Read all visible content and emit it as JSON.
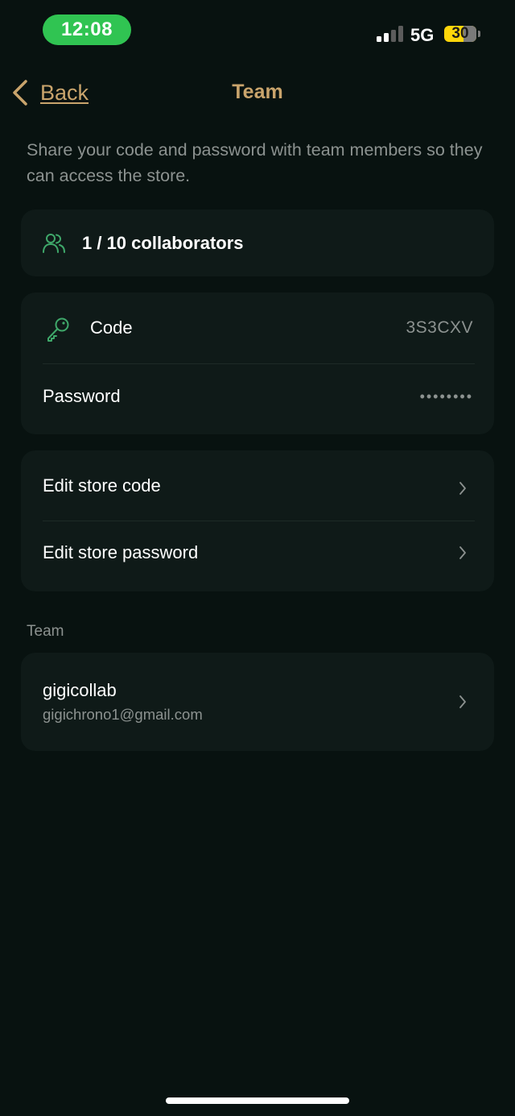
{
  "status_bar": {
    "time": "12:08",
    "network": "5G",
    "battery": "30",
    "colors": {
      "time_pill": "#30c452",
      "battery": "#ffd60a"
    }
  },
  "nav": {
    "back_label": "Back",
    "title": "Team",
    "accent_color": "#c9a46c"
  },
  "description": "Share your code and password with team members so they can access the store.",
  "collaborators": {
    "icon": "users-icon",
    "text": "1 / 10 collaborators"
  },
  "credentials": {
    "code_icon": "key-icon",
    "code_label": "Code",
    "code_value": "3S3CXV",
    "password_label": "Password",
    "password_value": "••••••••"
  },
  "actions": {
    "edit_code_label": "Edit store code",
    "edit_password_label": "Edit store password"
  },
  "team": {
    "section_label": "Team",
    "members": [
      {
        "name": "gigicollab",
        "email": "gigichrono1@gmail.com"
      }
    ]
  }
}
